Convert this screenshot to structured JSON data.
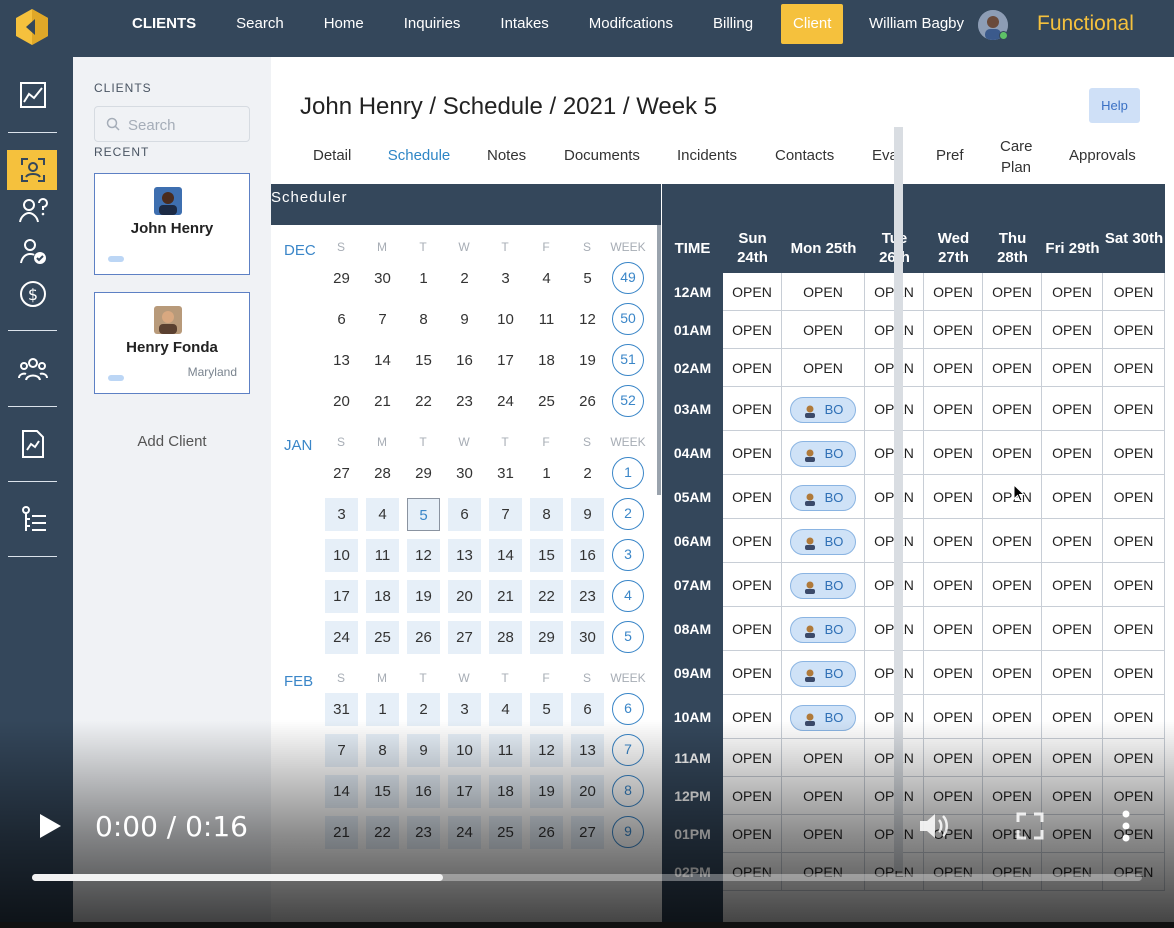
{
  "topnav": {
    "items": [
      "CLIENTS",
      "Search",
      "Home",
      "Inquiries",
      "Intakes",
      "Modifcations",
      "Billing",
      "Client"
    ],
    "user": "William Bagby",
    "brand": "Functional"
  },
  "rail": {
    "icons": [
      "dashboard-chart-icon",
      "client-scan-icon",
      "client-question-icon",
      "client-check-icon",
      "billing-dollar-icon",
      "group-icon",
      "report-icon",
      "settings-tree-icon"
    ]
  },
  "clients_panel": {
    "title": "CLIENTS",
    "search_placeholder": "Search",
    "recent_label": "RECENT",
    "cards": [
      {
        "name": "John Henry",
        "location": ""
      },
      {
        "name": "Henry Fonda",
        "location": "Maryland"
      }
    ],
    "add_client": "Add Client"
  },
  "page": {
    "title": "John Henry / Schedule / 2021 / Week 5",
    "help": "Help",
    "tabs": [
      "Detail",
      "Schedule",
      "Notes",
      "Documents",
      "Incidents",
      "Contacts",
      "Eval",
      "Pref",
      "Care Plan",
      "Approvals"
    ],
    "active_tab": "Schedule"
  },
  "scheduler": {
    "title": "Scheduler",
    "dow": [
      "S",
      "M",
      "T",
      "W",
      "T",
      "F",
      "S"
    ],
    "week_label": "WEEK",
    "months": [
      {
        "name": "DEC",
        "weeks": [
          [
            29,
            30,
            1,
            2,
            3,
            4,
            5,
            49
          ],
          [
            6,
            7,
            8,
            9,
            10,
            11,
            12,
            50
          ],
          [
            13,
            14,
            15,
            16,
            17,
            18,
            19,
            51
          ],
          [
            20,
            21,
            22,
            23,
            24,
            25,
            26,
            52
          ]
        ]
      },
      {
        "name": "JAN",
        "weeks": [
          [
            27,
            28,
            29,
            30,
            31,
            1,
            2,
            1
          ],
          [
            3,
            4,
            5,
            6,
            7,
            8,
            9,
            2
          ],
          [
            10,
            11,
            12,
            13,
            14,
            15,
            16,
            3
          ],
          [
            17,
            18,
            19,
            20,
            21,
            22,
            23,
            4
          ],
          [
            24,
            25,
            26,
            27,
            28,
            29,
            30,
            5
          ]
        ]
      },
      {
        "name": "FEB",
        "weeks": [
          [
            31,
            1,
            2,
            3,
            4,
            5,
            6,
            6
          ],
          [
            7,
            8,
            9,
            10,
            11,
            12,
            13,
            7
          ],
          [
            14,
            15,
            16,
            17,
            18,
            19,
            20,
            8
          ],
          [
            21,
            22,
            23,
            24,
            25,
            26,
            27,
            9
          ]
        ]
      }
    ],
    "today": {
      "month": "JAN",
      "week": 1,
      "day": 5
    }
  },
  "week_grid": {
    "time_header": "TIME",
    "days": [
      "Sun 24th",
      "Mon 25th",
      "Tue 26th",
      "Wed 27th",
      "Thu 28th",
      "Fri 29th",
      "Sat 30th"
    ],
    "times": [
      "12AM",
      "01AM",
      "02AM",
      "03AM",
      "04AM",
      "05AM",
      "06AM",
      "07AM",
      "08AM",
      "09AM",
      "10AM",
      "11AM",
      "12PM",
      "01PM",
      "02PM"
    ],
    "open_label": "OPEN",
    "booking_label": "BO",
    "booked": {
      "day": "Mon 25th",
      "times": [
        "03AM",
        "04AM",
        "05AM",
        "06AM",
        "07AM",
        "08AM",
        "09AM",
        "10AM"
      ]
    }
  },
  "video": {
    "time": "0:00 / 0:16",
    "progress": 0.37
  }
}
